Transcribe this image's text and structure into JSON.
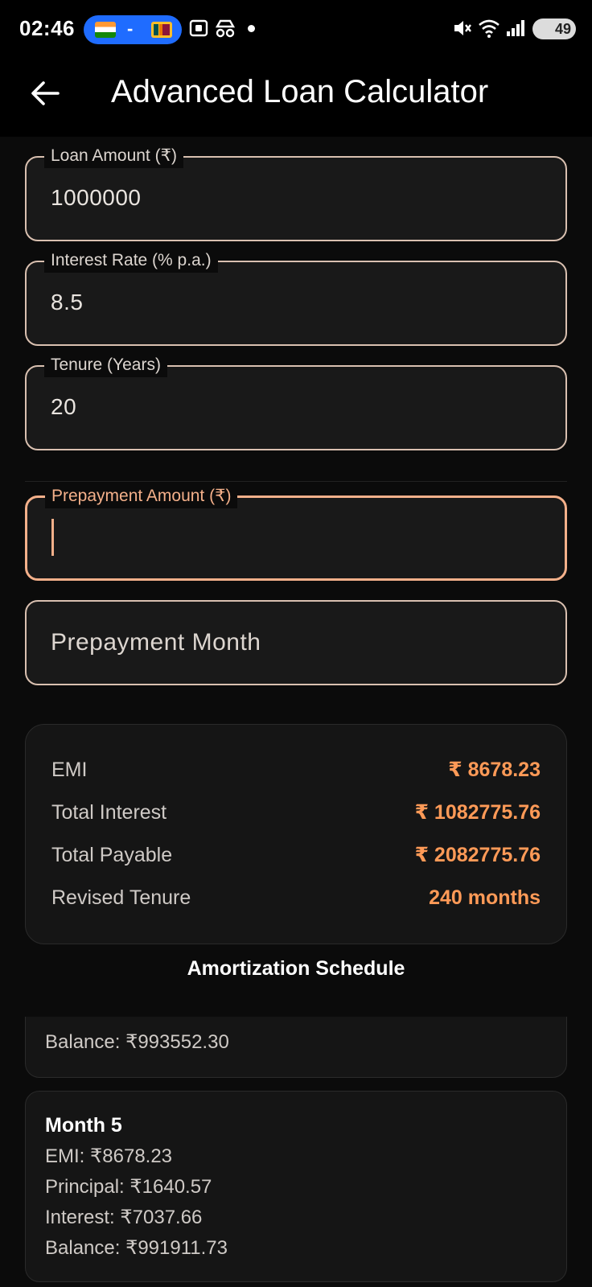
{
  "status": {
    "time": "02:46",
    "battery": "49"
  },
  "header": {
    "title": "Advanced Loan Calculator"
  },
  "fields": {
    "loan_amount": {
      "label": "Loan Amount (₹)",
      "value": "1000000"
    },
    "interest_rate": {
      "label": "Interest Rate (% p.a.)",
      "value": "8.5"
    },
    "tenure": {
      "label": "Tenure (Years)",
      "value": "20"
    },
    "prepayment_amount": {
      "label": "Prepayment Amount (₹)",
      "value": ""
    },
    "prepayment_month": {
      "placeholder": "Prepayment Month"
    }
  },
  "results": {
    "emi": {
      "label": "EMI",
      "value": "₹ 8678.23"
    },
    "total_interest": {
      "label": "Total Interest",
      "value": "₹ 1082775.76"
    },
    "total_payable": {
      "label": "Total Payable",
      "value": "₹ 2082775.76"
    },
    "revised_tenure": {
      "label": "Revised Tenure",
      "value": "240 months"
    }
  },
  "schedule": {
    "title": "Amortization Schedule",
    "partial_balance": "Balance: ₹993552.30",
    "month5": {
      "title": "Month 5",
      "emi": "EMI: ₹8678.23",
      "principal": "Principal: ₹1640.57",
      "interest": "Interest: ₹7037.66",
      "balance": "Balance: ₹991911.73"
    }
  },
  "colors": {
    "accent": "#ff9a57",
    "focus": "#f4b08a",
    "outline": "#d9c0b0"
  }
}
